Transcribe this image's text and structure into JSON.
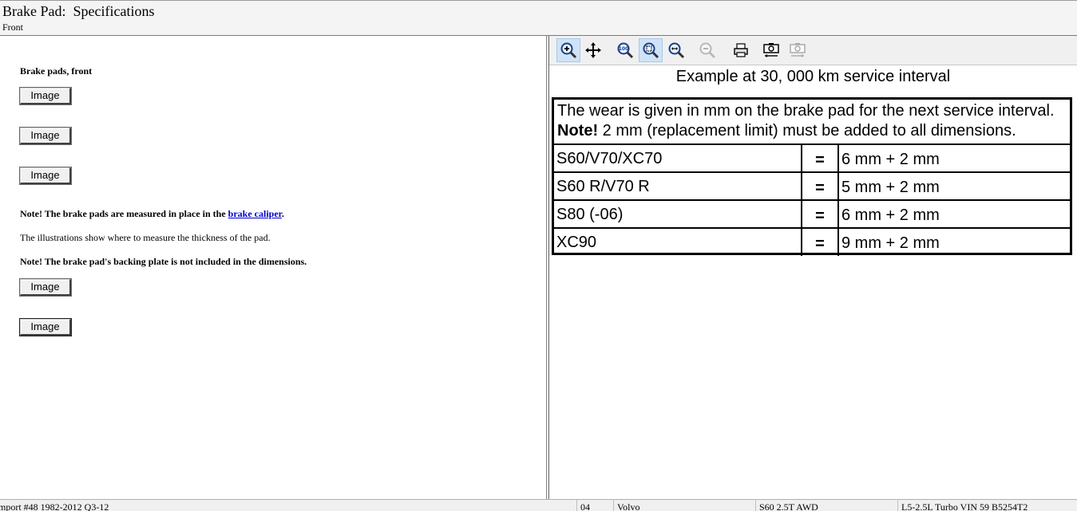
{
  "header": {
    "title": "Brake Pad:  Specifications",
    "subtitle": "Front"
  },
  "left": {
    "heading": "Brake pads, front",
    "image_button_label": "Image",
    "note1_prefix": "Note! The brake pads are measured in place in the ",
    "note1_link": "brake caliper",
    "note1_suffix": ".",
    "info_text": "The illustrations show where to measure the thickness of the pad.",
    "note2": "Note! The brake pad's backing plate is not included in the dimensions."
  },
  "toolbar": {
    "icons": [
      "zoom-in-icon",
      "pan-icon",
      "zoom-100-icon",
      "zoom-fit-icon",
      "zoom-width-icon",
      "zoom-out-icon",
      "print-icon",
      "copy-image-icon",
      "save-image-icon"
    ]
  },
  "diagram": {
    "title": "Example at 30, 000 km service interval",
    "header_line1": "The wear is given in mm on the brake pad for the next service interval.",
    "header_note_bold": "Note!",
    "header_line2_rest": " 2 mm (replacement limit) must be added to all dimensions.",
    "rows": [
      {
        "model": "S60/V70/XC70",
        "eq": "=",
        "value": "6 mm + 2 mm"
      },
      {
        "model": "S60 R/V70 R",
        "eq": "=",
        "value": "5 mm + 2 mm"
      },
      {
        "model": "S80 (-06)",
        "eq": "=",
        "value": "6 mm + 2 mm"
      },
      {
        "model": "XC90",
        "eq": "=",
        "value": "9 mm + 2 mm"
      }
    ]
  },
  "statusbar": {
    "source": "mport #48 1982-2012 Q3-12",
    "year": "04",
    "make": "Volvo",
    "model": "S60 2.5T AWD",
    "engine": "L5-2.5L Turbo VIN 59 B5254T2"
  }
}
